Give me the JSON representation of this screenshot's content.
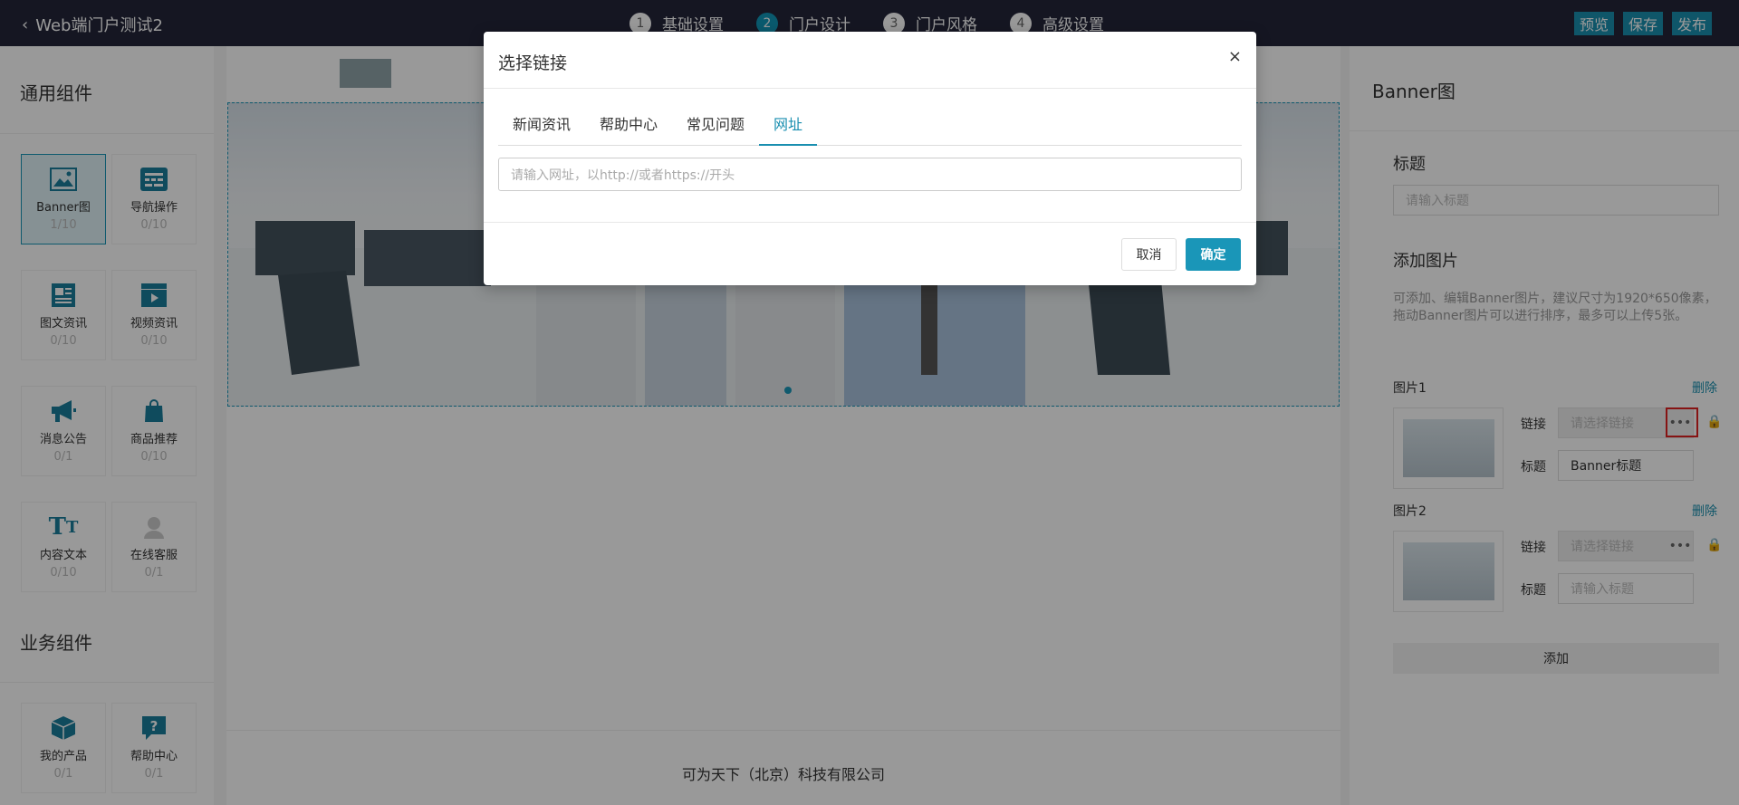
{
  "header": {
    "back_label": "Web端门户测试2",
    "steps": [
      {
        "num": "1",
        "label": "基础设置"
      },
      {
        "num": "2",
        "label": "门户设计"
      },
      {
        "num": "3",
        "label": "门户风格"
      },
      {
        "num": "4",
        "label": "高级设置"
      }
    ],
    "actions": {
      "preview": "预览",
      "save": "保存",
      "publish": "发布"
    }
  },
  "left": {
    "general_title": "通用组件",
    "general_items": [
      {
        "label": "Banner图",
        "count": "1/10",
        "icon": "image-icon"
      },
      {
        "label": "导航操作",
        "count": "0/10",
        "icon": "nav-icon"
      },
      {
        "label": "图文资讯",
        "count": "0/10",
        "icon": "article-icon"
      },
      {
        "label": "视频资讯",
        "count": "0/10",
        "icon": "video-icon"
      },
      {
        "label": "消息公告",
        "count": "0/1",
        "icon": "megaphone-icon"
      },
      {
        "label": "商品推荐",
        "count": "0/10",
        "icon": "bag-icon"
      },
      {
        "label": "内容文本",
        "count": "0/10",
        "icon": "text-icon"
      },
      {
        "label": "在线客服",
        "count": "0/1",
        "icon": "support-icon"
      }
    ],
    "business_title": "业务组件",
    "business_items": [
      {
        "label": "我的产品",
        "count": "0/1",
        "icon": "box-icon"
      },
      {
        "label": "帮助中心",
        "count": "0/1",
        "icon": "help-icon"
      }
    ]
  },
  "canvas": {
    "footer": "可为天下（北京）科技有限公司"
  },
  "right": {
    "title": "Banner图",
    "title_label": "标题",
    "title_placeholder": "请输入标题",
    "add_image_label": "添加图片",
    "note": "可添加、编辑Banner图片，建议尺寸为1920*650像素，拖动Banner图片可以进行排序，最多可以上传5张。",
    "images": [
      {
        "name": "图片1",
        "delete": "删除",
        "link_label": "链接",
        "link_placeholder": "请选择链接",
        "title_label": "标题",
        "title_value": "Banner标题",
        "title_placeholder": ""
      },
      {
        "name": "图片2",
        "delete": "删除",
        "link_label": "链接",
        "link_placeholder": "请选择链接",
        "title_label": "标题",
        "title_value": "",
        "title_placeholder": "请输入标题"
      }
    ],
    "add_button": "添加"
  },
  "modal": {
    "title": "选择链接",
    "close": "×",
    "tabs": [
      "新闻资讯",
      "帮助中心",
      "常见问题",
      "网址"
    ],
    "url_placeholder": "请输入网址，以http://或者https://开头",
    "cancel": "取消",
    "confirm": "确定"
  },
  "colors": {
    "accent": "#1a96b8",
    "topbar": "#23263a",
    "highlight": "#e02020"
  }
}
